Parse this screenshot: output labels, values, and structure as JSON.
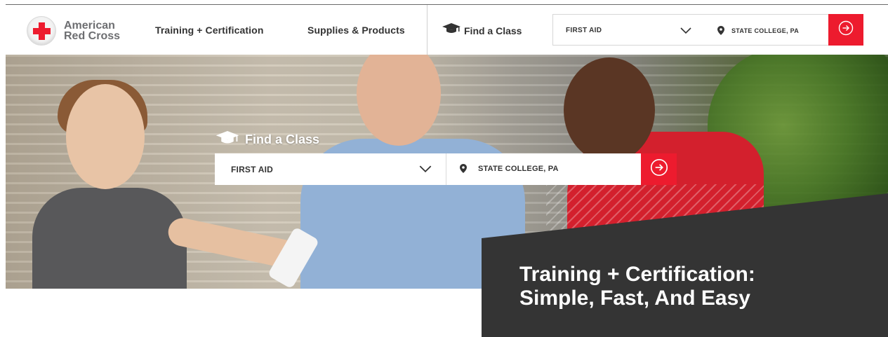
{
  "header": {
    "logo": {
      "line1": "American",
      "line2": "Red Cross",
      "icon": "red-cross-logo"
    },
    "nav": [
      {
        "label": "Training + Certification"
      },
      {
        "label": "Supplies & Products"
      }
    ],
    "find_class": {
      "label": "Find a Class",
      "icon": "graduation-cap-icon"
    },
    "search": {
      "course_value": "FIRST AID",
      "location_value": "STATE COLLEGE, PA",
      "submit_icon": "arrow-right-circle-icon"
    }
  },
  "hero": {
    "find_class": {
      "label": "Find a Class",
      "icon": "graduation-cap-icon"
    },
    "search": {
      "course_value": "FIRST AID",
      "location_value": "STATE COLLEGE, PA",
      "submit_icon": "arrow-right-circle-icon"
    },
    "panel": {
      "line1": "Training + Certification:",
      "line2": "Simple, Fast, And Easy"
    }
  },
  "colors": {
    "brand_red": "#ed1b2e",
    "panel_dark": "#343434",
    "text_dark": "#333333",
    "logo_gray": "#6d6e71"
  }
}
